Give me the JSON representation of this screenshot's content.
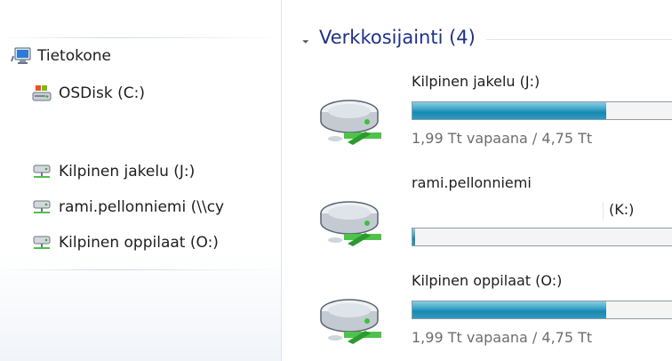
{
  "nav": {
    "computer": "Tietokone",
    "items": [
      {
        "label": "OSDisk (C:)"
      },
      {
        "label": "Kilpinen jakelu (J:)"
      },
      {
        "label": "rami.pellonniemi (\\\\cy"
      },
      {
        "label": "Kilpinen oppilaat (O:)"
      }
    ]
  },
  "group": {
    "title": "Verkkosijainti (4)"
  },
  "drives": [
    {
      "name": "Kilpinen jakelu (J:)",
      "space": "1,99 Tt vapaana / 4,75 Tt",
      "used_fraction": 0.68
    },
    {
      "name": "rami.pellonniemi",
      "letter": "(K:)",
      "used_fraction": 0.01
    },
    {
      "name": "Kilpinen oppilaat (O:)",
      "space": "1,99 Tt vapaana / 4,75 Tt",
      "used_fraction": 0.68
    }
  ],
  "colors": {
    "accent_title": "#1e3287",
    "bar_fill": "#2d9bc1"
  }
}
